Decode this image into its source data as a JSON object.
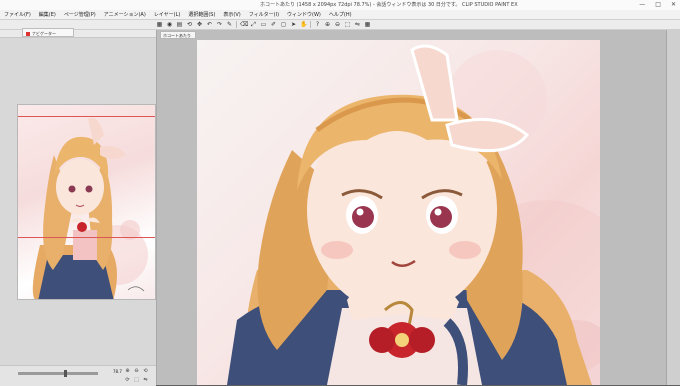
{
  "window": {
    "title": "ホコートあたり (1458 x 2094px 72dpi 78.7%)  - 会話ウィンドウ表示は 30 日分です。 CLIP STUDIO PAINT EX",
    "controls": [
      "—",
      "□",
      "✕"
    ]
  },
  "menu": [
    "ファイル(F)",
    "編集(E)",
    "ページ管理(P)",
    "アニメーション(A)",
    "レイヤー(L)",
    "選択範囲(S)",
    "表示(V)",
    "フィルター(I)",
    "ウィンドウ(W)",
    "ヘルプ(H)"
  ],
  "toolbar": {
    "icons": [
      "grid-icon",
      "eye-icon",
      "layer-icon",
      "rotate-icon",
      "move-icon",
      "undo-icon",
      "redo-icon",
      "brush-icon",
      "clear-icon",
      "transform-icon",
      "select-icon",
      "pen-icon",
      "eraser-icon",
      "cursor-icon",
      "hand-icon",
      "help-icon",
      "zoom-in-icon",
      "zoom-out-icon",
      "fit-icon",
      "flip-icon",
      "grid2-icon"
    ],
    "glyphs": [
      "▦",
      "◉",
      "▤",
      "⟲",
      "✥",
      "↶",
      "↷",
      "✎",
      "⌫",
      "⤢",
      "▭",
      "✐",
      "◻",
      "➤",
      "✋",
      "?",
      "⊕",
      "⊖",
      "⬚",
      "⇋",
      "▦"
    ]
  },
  "navigator": {
    "tab_label": "ナビゲーター",
    "zoom_value": "78.7",
    "zoom_fraction": 0.6,
    "icon_glyphs": [
      "⊕",
      "⊖",
      "⟲",
      "⟳",
      "⬚",
      "⇋"
    ]
  },
  "canvas": {
    "doc_tab": "ホコートあたり"
  },
  "colors": {
    "accent": "#cc2d2d",
    "hair": "#e8b06a",
    "jacket": "#3e4f7a",
    "ribbon": "#f7d8cf",
    "bow": "#c8242b"
  }
}
